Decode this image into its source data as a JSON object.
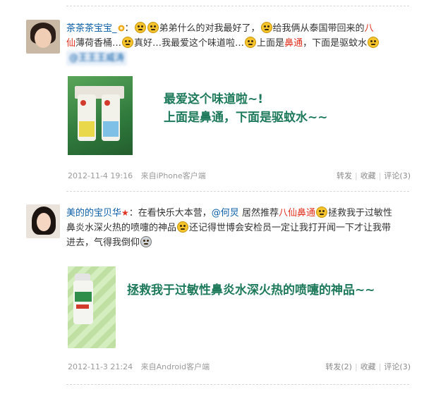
{
  "posts": [
    {
      "username": "茶茶茶宝宝_",
      "text_a": "弟弟什么的对我最好了，",
      "text_b": "给我俩从泰国带回来的",
      "text_b_red": "八",
      "text_c_red": "仙",
      "text_c": "薄荷香桶…",
      "text_d": "真好…我最爱这个味道啦…",
      "text_e": "上面是",
      "text_e_red": "鼻通",
      "text_f": "，下面是驱蚊水",
      "blurred_line": "@王王王威涛",
      "caption_line1": "最爱这个味道啦~!",
      "caption_line2": "上面是鼻通，下面是驱蚊水~~",
      "timestamp": "2012-11-4 19:16",
      "source": "来自iPhone客户端",
      "repost": "转发",
      "favorite": "收藏",
      "comment": "评论(3)"
    },
    {
      "username": "美的的宝贝华",
      "text_a": "：在看快乐大本营，",
      "mention": "@何炅",
      "text_b": " 居然推荐",
      "text_b_red": "八仙鼻通",
      "text_c": "拯救我于过敏性",
      "text_d": "鼻炎水深火热的喷嚏的神品",
      "text_e": "还记得世博会安检员一定让我打开闻一下才让我带",
      "text_f": "进去，气得我倒仰",
      "caption_line1": "拯救我于过敏性鼻炎水深火热的喷嚏的神品~~",
      "timestamp": "2012-11-3 21:24",
      "source": "来自Android客户端",
      "repost": "转发(2)",
      "favorite": "收藏",
      "comment": "评论(3)"
    }
  ],
  "colors": {
    "link": "#0c5fa8",
    "highlight": "#e0301e",
    "caption": "#1e7a5a",
    "meta": "#9a9a9a"
  },
  "icons": [
    "laughing-tears-emoji",
    "shy-blush-emoji",
    "grin-emoji",
    "gold-badge-icon",
    "red-star-icon",
    "skull-shocked-emoji"
  ]
}
